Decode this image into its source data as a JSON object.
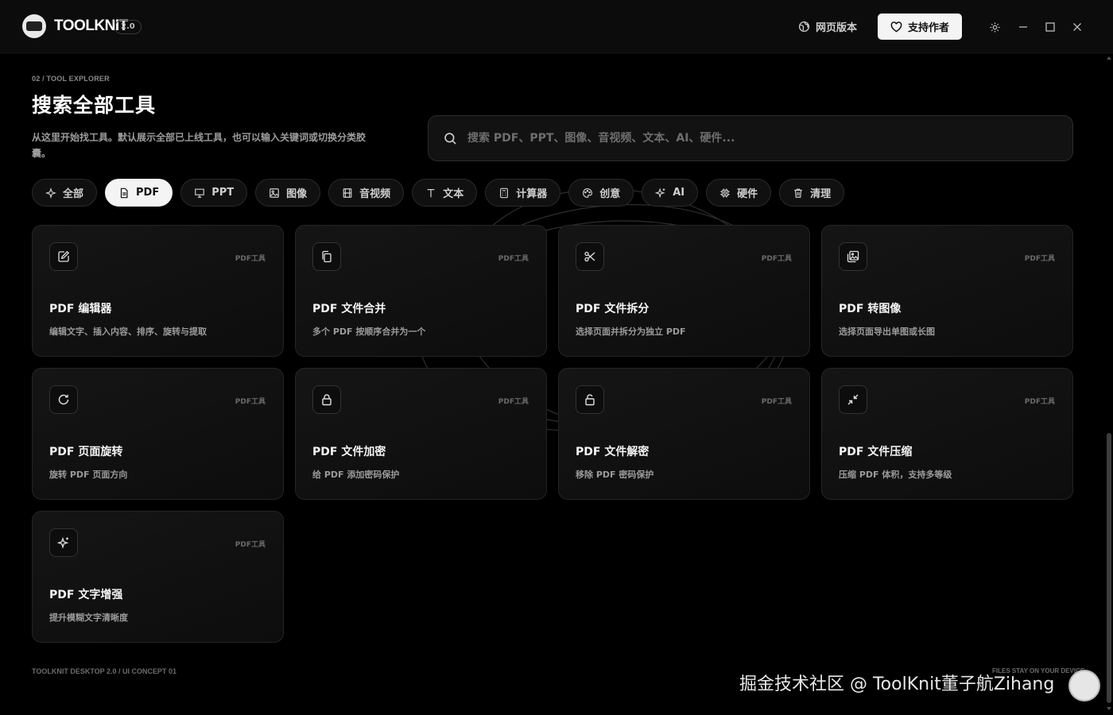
{
  "app": {
    "brand": "TOOLKNIT",
    "version": "2.0",
    "web_label": "网页版本",
    "support_label": "支持作者"
  },
  "page": {
    "breadcrumb": "02 / TOOL EXPLORER",
    "title": "搜索全部工具",
    "description": "从这里开始找工具。默认展示全部已上线工具，也可以输入关键词或切换分类胶囊。"
  },
  "search": {
    "placeholder": "搜索 PDF、PPT、图像、音视频、文本、AI、硬件..."
  },
  "categories": [
    {
      "label": "全部",
      "icon": "sparkle-icon",
      "active": false
    },
    {
      "label": "PDF",
      "icon": "document-icon",
      "active": true
    },
    {
      "label": "PPT",
      "icon": "presentation-icon",
      "active": false
    },
    {
      "label": "图像",
      "icon": "image-icon",
      "active": false
    },
    {
      "label": "音视频",
      "icon": "film-icon",
      "active": false
    },
    {
      "label": "文本",
      "icon": "text-icon",
      "active": false
    },
    {
      "label": "计算器",
      "icon": "calculator-icon",
      "active": false
    },
    {
      "label": "创意",
      "icon": "palette-icon",
      "active": false
    },
    {
      "label": "AI",
      "icon": "sparkle-icon",
      "active": false
    },
    {
      "label": "硬件",
      "icon": "chip-icon",
      "active": false
    },
    {
      "label": "清理",
      "icon": "trash-icon",
      "active": false
    }
  ],
  "tools": [
    {
      "title": "PDF 编辑器",
      "subtitle": "编辑文字、插入内容、排序、旋转与提取",
      "tag": "PDF工具",
      "icon": "edit-icon"
    },
    {
      "title": "PDF 文件合并",
      "subtitle": "多个 PDF 按顺序合并为一个",
      "tag": "PDF工具",
      "icon": "copy-icon"
    },
    {
      "title": "PDF 文件拆分",
      "subtitle": "选择页面并拆分为独立 PDF",
      "tag": "PDF工具",
      "icon": "scissors-icon"
    },
    {
      "title": "PDF 转图像",
      "subtitle": "选择页面导出单图或长图",
      "tag": "PDF工具",
      "icon": "images-icon"
    },
    {
      "title": "PDF 页面旋转",
      "subtitle": "旋转 PDF 页面方向",
      "tag": "PDF工具",
      "icon": "rotate-icon"
    },
    {
      "title": "PDF 文件加密",
      "subtitle": "给 PDF 添加密码保护",
      "tag": "PDF工具",
      "icon": "lock-icon"
    },
    {
      "title": "PDF 文件解密",
      "subtitle": "移除 PDF 密码保护",
      "tag": "PDF工具",
      "icon": "unlock-icon"
    },
    {
      "title": "PDF 文件压缩",
      "subtitle": "压缩 PDF 体积，支持多等级",
      "tag": "PDF工具",
      "icon": "minimize-icon"
    },
    {
      "title": "PDF 文字增强",
      "subtitle": "提升模糊文字清晰度",
      "tag": "PDF工具",
      "icon": "sparkle-icon"
    }
  ],
  "footer": {
    "left": "TOOLKNIT DESKTOP 2.0 / UI CONCEPT 01",
    "right": "FILES STAY ON YOUR DEVICE"
  },
  "watermark": "掘金技术社区 @ ToolKnit董子航Zihang"
}
